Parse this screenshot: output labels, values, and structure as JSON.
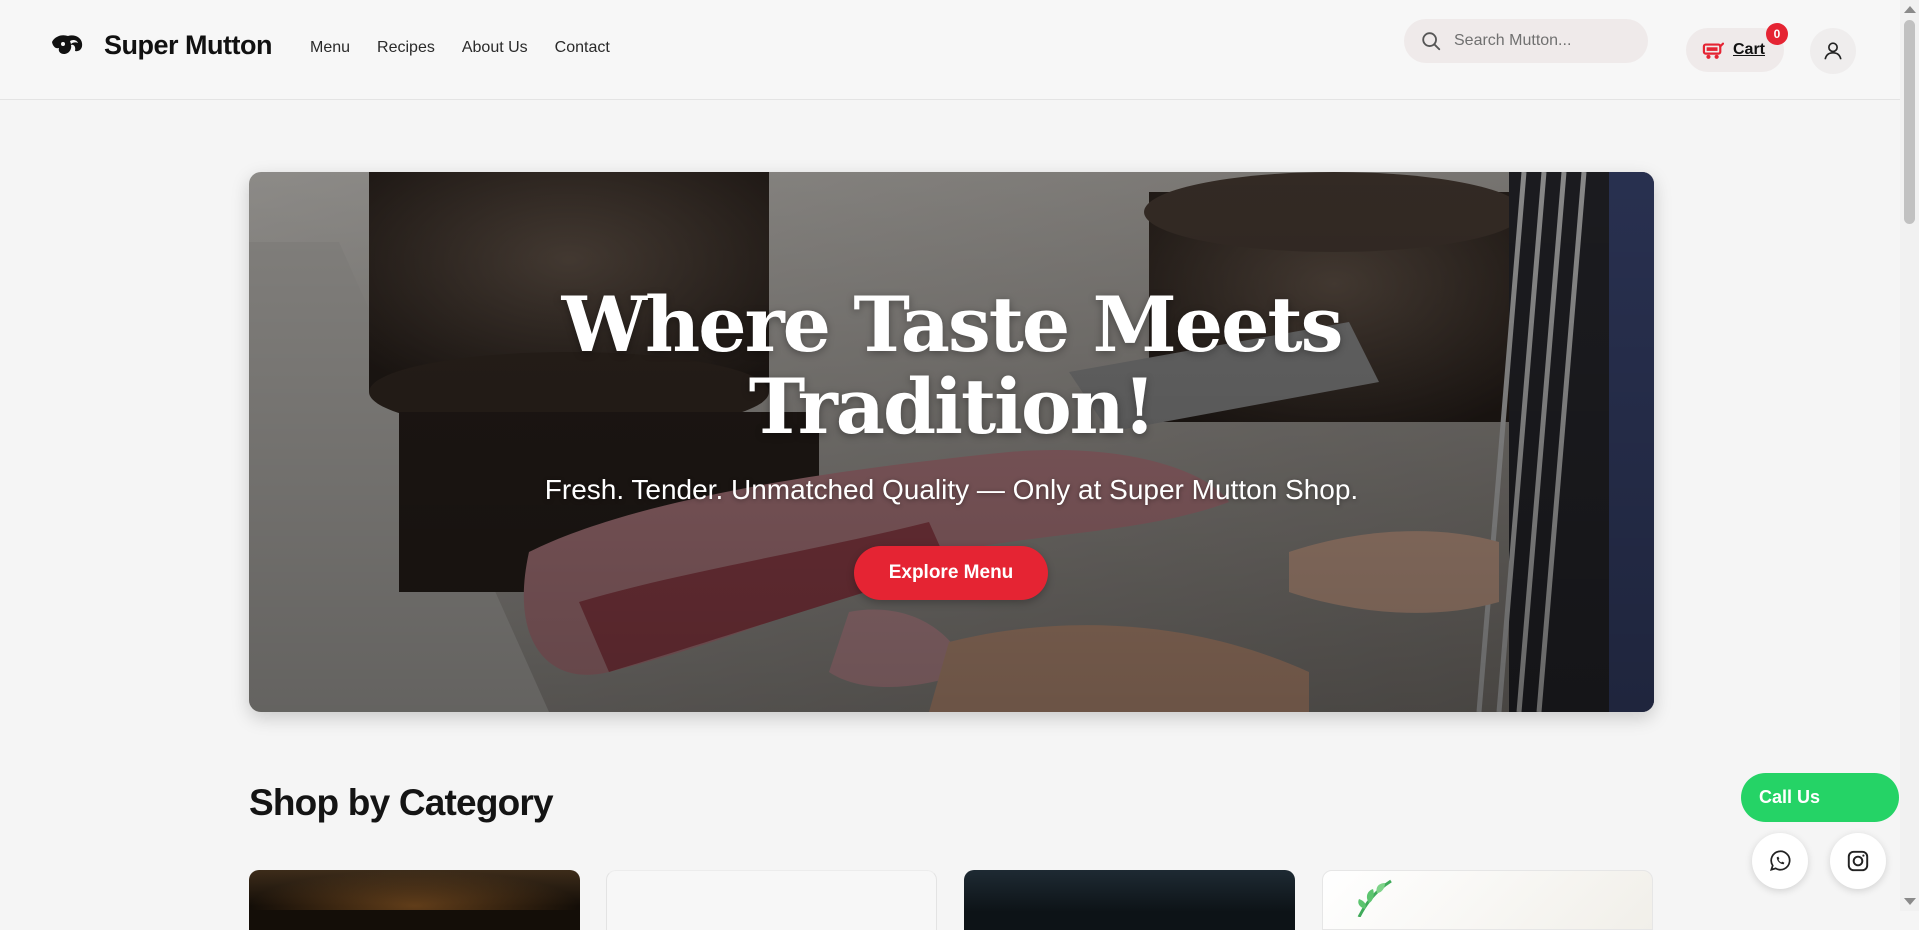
{
  "brand": {
    "name": "Super Mutton",
    "logo_icon": "ram-head-icon"
  },
  "nav": {
    "items": [
      "Menu",
      "Recipes",
      "About Us",
      "Contact"
    ]
  },
  "search": {
    "placeholder": "Search Mutton...",
    "icon": "search-icon"
  },
  "cart": {
    "label": "Cart",
    "count": "0",
    "icon": "cart-icon"
  },
  "account": {
    "icon": "user-icon"
  },
  "hero": {
    "title_line1": "Where Taste Meets",
    "title_line2": "Tradition!",
    "subtitle": "Fresh. Tender. Unmatched Quality — Only at Super Mutton Shop.",
    "cta": "Explore Menu"
  },
  "category": {
    "title": "Shop by Category"
  },
  "floating": {
    "call_label": "Call Us",
    "whatsapp_icon": "whatsapp-icon",
    "instagram_icon": "instagram-icon"
  },
  "colors": {
    "accent_red": "#e52433",
    "call_green": "#25d366",
    "page_bg": "#f5f5f5"
  }
}
